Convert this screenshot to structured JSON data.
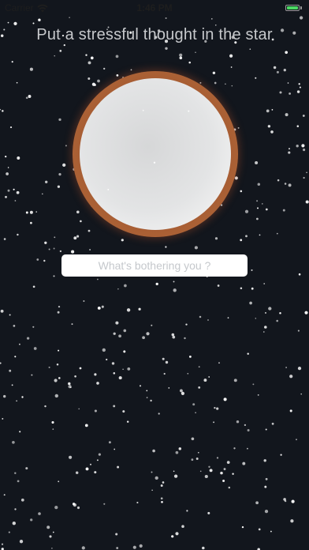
{
  "status_bar": {
    "carrier": "Carrier",
    "time": "1:46 PM",
    "wifi_icon": "wifi-icon",
    "battery_icon": "battery-icon",
    "battery_level": 1.0,
    "battery_color": "#4cd964"
  },
  "heading": "Put a stressful thought in the star",
  "thought_input": {
    "value": "",
    "placeholder": "What's bothering you ?"
  },
  "colors": {
    "background": "#12161d",
    "star_rim": "#b36a3a",
    "star_core": "#e3e4e5",
    "heading_text": "#c7c9cc"
  }
}
